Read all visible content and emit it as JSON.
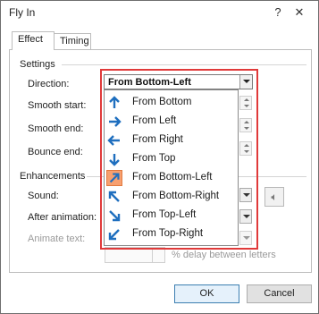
{
  "window": {
    "title": "Fly In",
    "help_glyph": "?",
    "close_glyph": "✕"
  },
  "tabs": [
    {
      "label": "Effect",
      "active": true
    },
    {
      "label": "Timing",
      "active": false
    }
  ],
  "settings": {
    "heading": "Settings",
    "direction_label": "Direction:",
    "smooth_start_label": "Smooth start:",
    "smooth_end_label": "Smooth end:",
    "bounce_end_label": "Bounce end:"
  },
  "direction_combo": {
    "value": "From Bottom-Left",
    "options": [
      {
        "label": "From Bottom",
        "icon": "arrow-up-icon"
      },
      {
        "label": "From Left",
        "icon": "arrow-right-icon"
      },
      {
        "label": "From Right",
        "icon": "arrow-left-icon"
      },
      {
        "label": "From Top",
        "icon": "arrow-down-icon"
      },
      {
        "label": "From Bottom-Left",
        "icon": "arrow-up-right-icon",
        "selected": true
      },
      {
        "label": "From Bottom-Right",
        "icon": "arrow-up-left-icon"
      },
      {
        "label": "From Top-Left",
        "icon": "arrow-down-right-icon"
      },
      {
        "label": "From Top-Right",
        "icon": "arrow-down-left-icon"
      }
    ]
  },
  "enhancements": {
    "heading": "Enhancements",
    "sound_label": "Sound:",
    "after_animation_label": "After animation:",
    "animate_text_label": "Animate text:",
    "delay_label": "% delay between letters"
  },
  "buttons": {
    "ok": "OK",
    "cancel": "Cancel"
  },
  "colors": {
    "accent": "#1f6fbf",
    "highlight_border": "#e03a3a",
    "selected_bg": "#f7a070"
  }
}
